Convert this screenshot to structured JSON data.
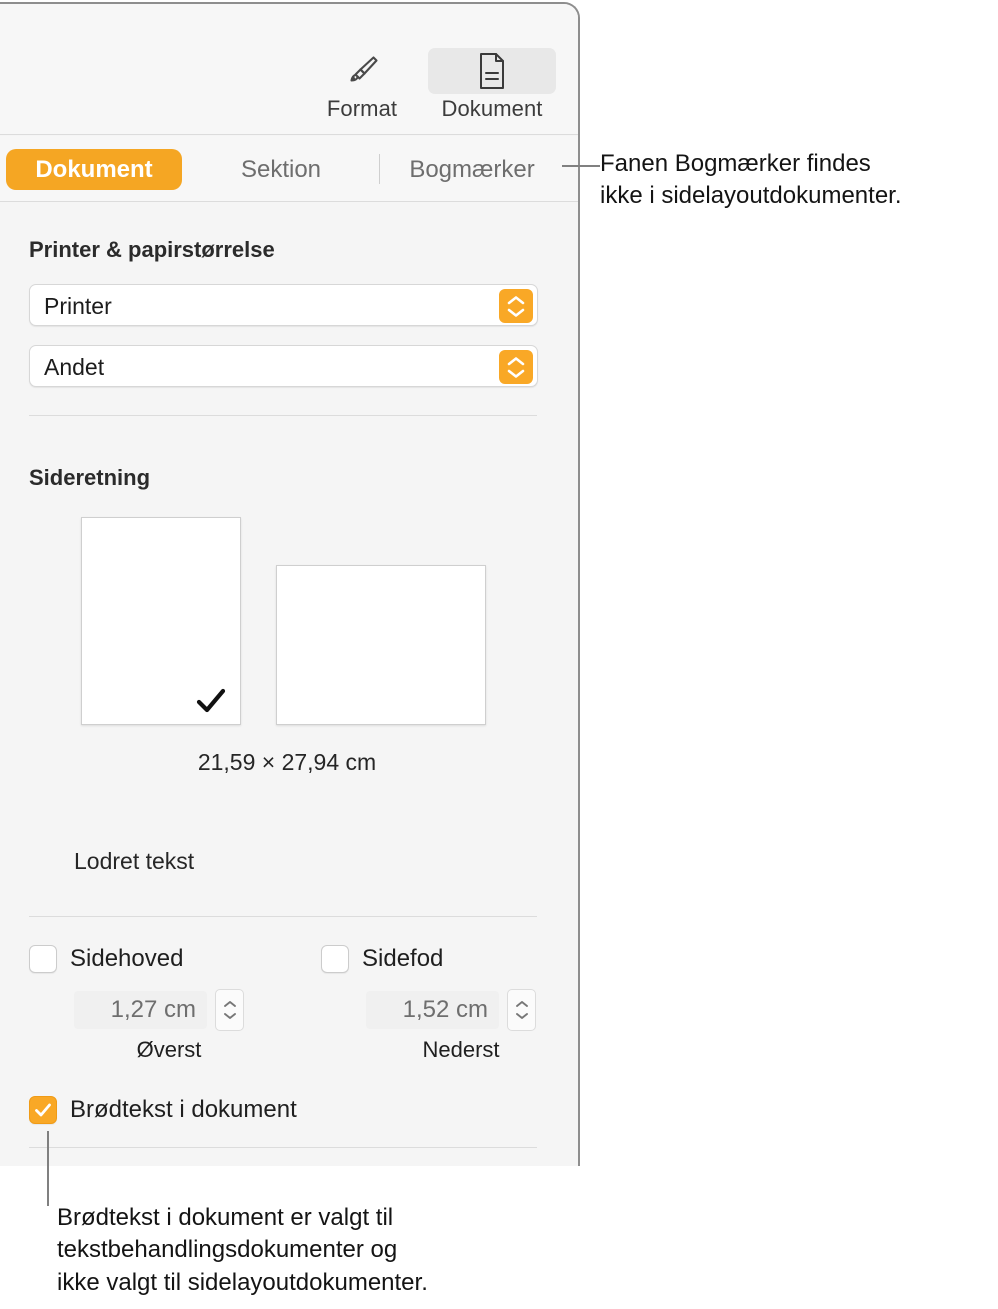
{
  "toolbar": {
    "items": [
      {
        "label": "Format",
        "icon": "paintbrush-icon",
        "selected": false
      },
      {
        "label": "Dokument",
        "icon": "document-icon",
        "selected": true
      }
    ]
  },
  "tabs": [
    {
      "label": "Dokument",
      "active": true
    },
    {
      "label": "Sektion",
      "active": false
    },
    {
      "label": "Bogmærker",
      "active": false
    }
  ],
  "sections": {
    "printer": {
      "title": "Printer & papirstørrelse",
      "printer_popup_value": "Printer",
      "paper_popup_value": "Andet"
    },
    "orientation": {
      "title": "Sideretning",
      "portrait_selected": true,
      "landscape_selected": false,
      "paper_size": "21,59 × 27,94 cm"
    },
    "vertical_text": {
      "label": "Lodret tekst"
    },
    "header_footer": {
      "header": {
        "label": "Sidehoved",
        "checked": false,
        "value": "1,27 cm",
        "caption": "Øverst"
      },
      "footer": {
        "label": "Sidefod",
        "checked": false,
        "value": "1,52 cm",
        "caption": "Nederst"
      }
    },
    "body_text": {
      "label": "Brødtekst i dokument",
      "checked": true
    }
  },
  "callouts": [
    {
      "id": "bookmarks-tab",
      "text": "Fanen Bogmærker findes\nikke i sidelayoutdokumenter."
    },
    {
      "id": "body-text-checkbox",
      "text": "Brødtekst i dokument er valgt til\ntekstbehandlingsdokumenter og\nikke valgt til sidelayoutdokumenter."
    }
  ],
  "colors": {
    "accent": "#f5a623",
    "popup_arrow": "#f9a826",
    "panel_bg": "#f5f5f5",
    "toolbar_bg": "#f7f7f7",
    "divider": "#dcdcdc",
    "text": "#1f1f1f"
  }
}
